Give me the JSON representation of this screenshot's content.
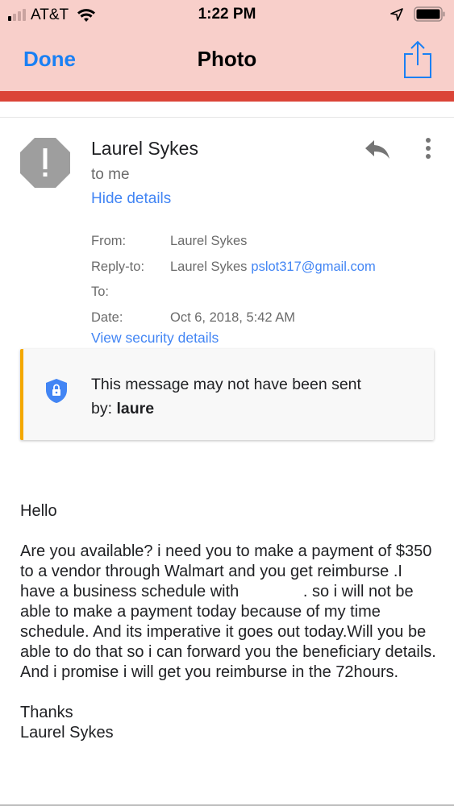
{
  "status_bar": {
    "carrier": "AT&T",
    "time": "1:22 PM",
    "signal_bars_active": 1,
    "signal_bars_total": 4,
    "icons": [
      "signal-icon",
      "wifi-icon",
      "location-arrow-icon",
      "battery-icon"
    ]
  },
  "nav": {
    "done_label": "Done",
    "title": "Photo",
    "share_icon": "share-icon"
  },
  "colors": {
    "nav_bg": "#f8cfca",
    "accent_red": "#db4437",
    "ios_blue": "#1a80f4",
    "link_blue": "#4285f4",
    "warning_stripe": "#f4a800"
  },
  "email": {
    "sender": "Laurel Sykes",
    "recipient_summary": "to me",
    "hide_details_label": "Hide details",
    "avatar_icon": "warning-octagon-icon",
    "details": {
      "from_label": "From:",
      "from_value": "Laurel Sykes",
      "reply_to_label": "Reply-to:",
      "reply_to_name": "Laurel Sykes",
      "reply_to_email": "pslot317@gmail.com",
      "to_label": "To:",
      "to_value": "",
      "date_label": "Date:",
      "date_value": "Oct 6, 2018, 5:42 AM"
    },
    "view_security_label": "View security details",
    "warning": {
      "line1": "This message may not have been sent",
      "by_prefix": "by: ",
      "by_value": "laure"
    },
    "body": {
      "greeting": "Hello",
      "paragraph": "Are you available? i need you to make a payment of $350 to a vendor through  Walmart and you get reimburse .I have a business schedule with ",
      "paragraph_cont": ". so i will not be able to make a payment today because of my time schedule. And its imperative it goes out today.Will you be able to do that so i can forward you the beneficiary details. And i promise i will get you reimburse in the 72hours.",
      "closing": "Thanks",
      "signature": "Laurel Sykes"
    }
  }
}
